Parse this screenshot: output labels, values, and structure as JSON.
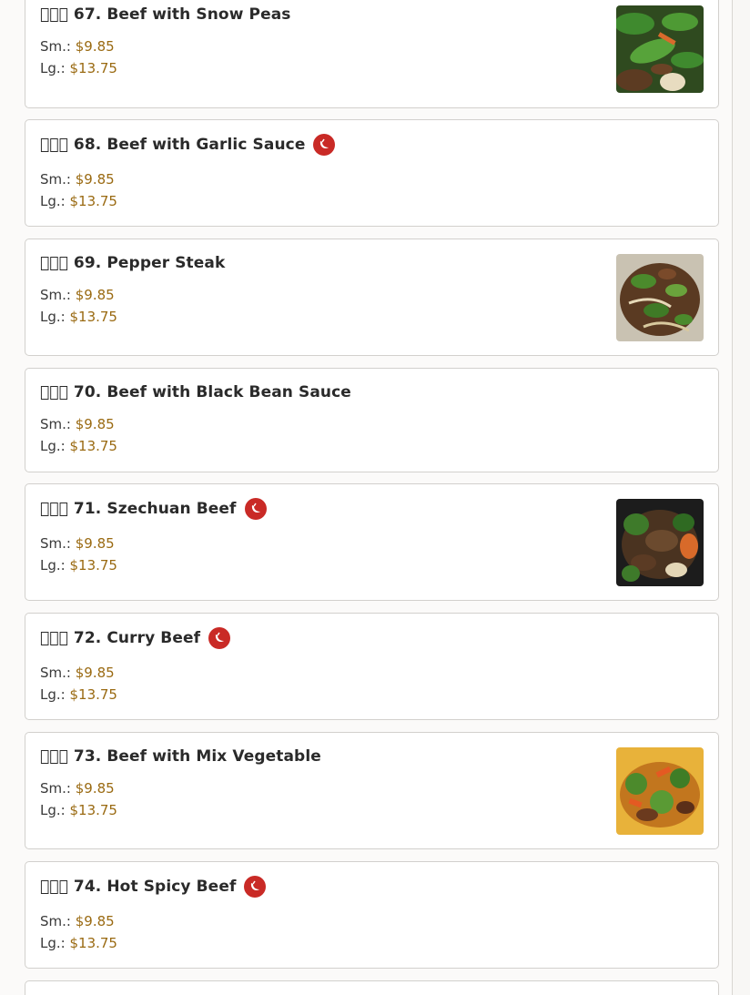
{
  "currency_labels": {
    "small": "Sm.:",
    "large": "Lg.:"
  },
  "accent_color": "#9a6a12",
  "spicy_color": "#c92a26",
  "items": [
    {
      "title": "\u0000\u0000\u0000 67. Beef with Snow Peas",
      "small_price": "$9.85",
      "large_price": "$13.75",
      "spicy": false,
      "image": "snow-peas-photo"
    },
    {
      "title": "\u0000\u0000\u0000 68. Beef with Garlic Sauce",
      "small_price": "$9.85",
      "large_price": "$13.75",
      "spicy": true,
      "image": null
    },
    {
      "title": "\u0000\u0000\u0000 69. Pepper Steak",
      "small_price": "$9.85",
      "large_price": "$13.75",
      "spicy": false,
      "image": "pepper-steak-photo"
    },
    {
      "title": "\u0000\u0000\u0000 70. Beef with Black Bean Sauce",
      "small_price": "$9.85",
      "large_price": "$13.75",
      "spicy": false,
      "image": null
    },
    {
      "title": "\u0000\u0000\u0000 71. Szechuan Beef",
      "small_price": "$9.85",
      "large_price": "$13.75",
      "spicy": true,
      "image": "szechuan-beef-photo"
    },
    {
      "title": "\u0000\u0000\u0000 72. Curry Beef",
      "small_price": "$9.85",
      "large_price": "$13.75",
      "spicy": true,
      "image": null
    },
    {
      "title": "\u0000\u0000\u0000 73. Beef with Mix Vegetable",
      "small_price": "$9.85",
      "large_price": "$13.75",
      "spicy": false,
      "image": "mix-vegetable-photo"
    },
    {
      "title": "\u0000\u0000\u0000 74. Hot Spicy Beef",
      "small_price": "$9.85",
      "large_price": "$13.75",
      "spicy": true,
      "image": null
    }
  ]
}
